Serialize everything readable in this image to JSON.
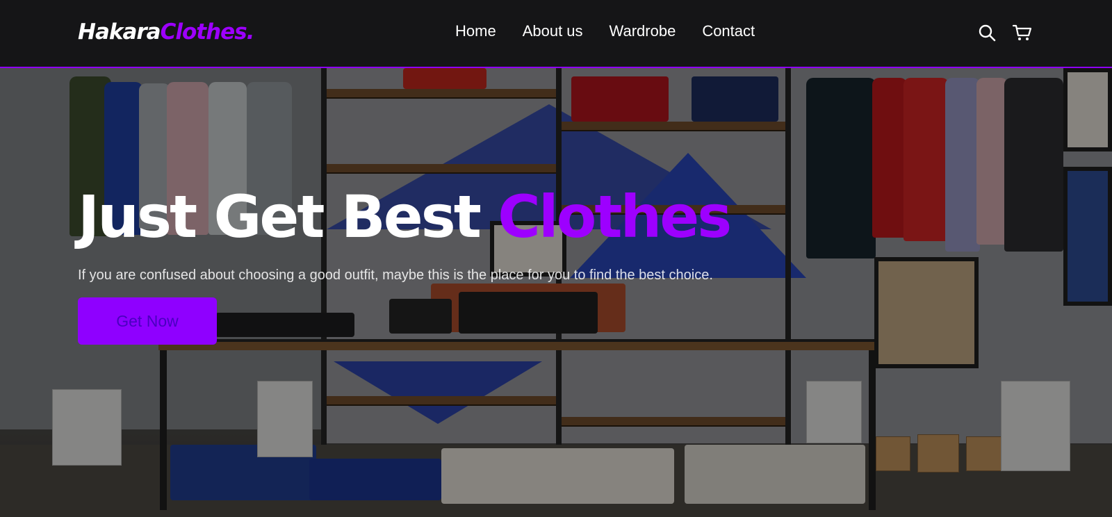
{
  "brand": {
    "name_part1": "Hakara",
    "name_part2": "Clothes."
  },
  "nav": {
    "links": [
      {
        "label": "Home"
      },
      {
        "label": "About us"
      },
      {
        "label": "Wardrobe"
      },
      {
        "label": "Contact"
      }
    ],
    "icons": [
      "search-icon",
      "cart-icon"
    ]
  },
  "hero": {
    "title_main": "Just Get Best ",
    "title_accent": "Clothes",
    "subtitle": "If you are confused about choosing a good outfit, maybe this is the place for you to find the best choice.",
    "cta_label": "Get Now"
  },
  "colors": {
    "accent": "#9d00ff",
    "nav_background": "#121214",
    "text": "#ffffff"
  }
}
